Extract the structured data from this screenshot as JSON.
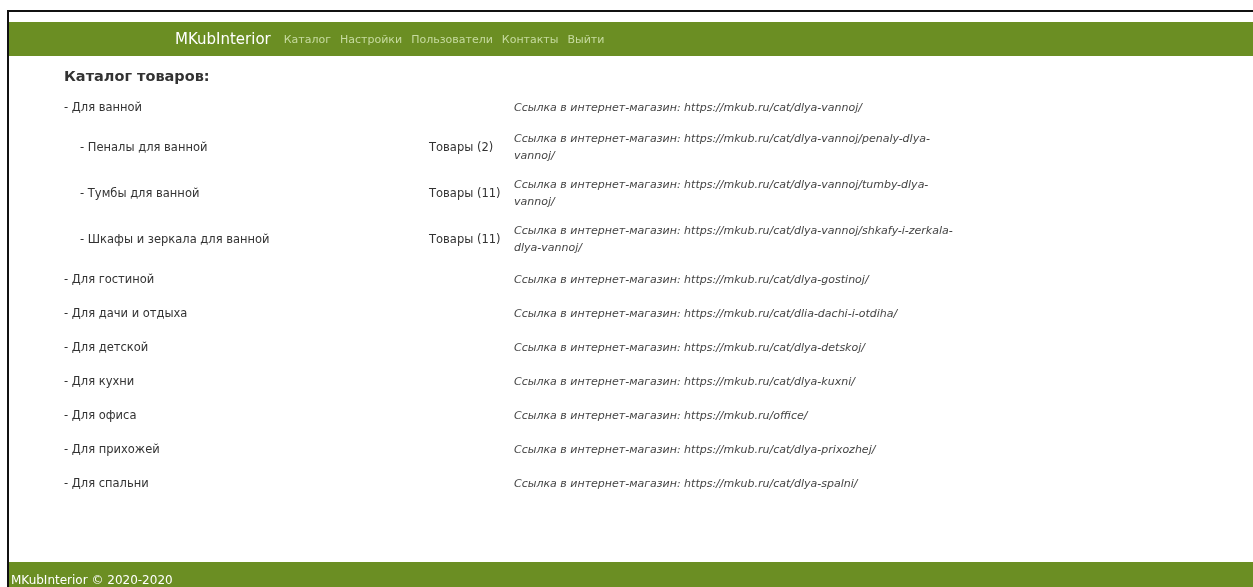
{
  "navbar": {
    "brand": "MKubInterior",
    "links": [
      "Каталог",
      "Настройки",
      "Пользователи",
      "Контакты",
      "Выйти"
    ]
  },
  "heading": "Каталог товаров:",
  "categories": [
    {
      "name": "- Для ванной",
      "link": "Ссылка в интернет-магазин: https://mkub.ru/cat/dlya-vannoj/",
      "children": [
        {
          "name": "- Пеналы для ванной",
          "count": "Товары (2)",
          "link": "Ссылка в интернет-магазин: https://mkub.ru/cat/dlya-vannoj/penaly-dlya-vannoj/"
        },
        {
          "name": "- Тумбы для ванной",
          "count": "Товары (11)",
          "link": "Ссылка в интернет-магазин: https://mkub.ru/cat/dlya-vannoj/tumby-dlya-vannoj/"
        },
        {
          "name": "- Шкафы и зеркала для ванной",
          "count": "Товары (11)",
          "link": "Ссылка в интернет-магазин: https://mkub.ru/cat/dlya-vannoj/shkafy-i-zerkala-dlya-vannoj/"
        }
      ]
    },
    {
      "name": "- Для гостиной",
      "link": "Ссылка в интернет-магазин: https://mkub.ru/cat/dlya-gostinoj/"
    },
    {
      "name": "- Для дачи и отдыха",
      "link": "Ссылка в интернет-магазин: https://mkub.ru/cat/dlia-dachi-i-otdiha/"
    },
    {
      "name": "- Для детской",
      "link": "Ссылка в интернет-магазин: https://mkub.ru/cat/dlya-detskoj/"
    },
    {
      "name": "- Для кухни",
      "link": "Ссылка в интернет-магазин: https://mkub.ru/cat/dlya-kuxni/"
    },
    {
      "name": "- Для офиса",
      "link": "Ссылка в интернет-магазин: https://mkub.ru/office/"
    },
    {
      "name": "- Для прихожей",
      "link": "Ссылка в интернет-магазин: https://mkub.ru/cat/dlya-prixozhej/"
    },
    {
      "name": "- Для спальни",
      "link": "Ссылка в интернет-магазин: https://mkub.ru/cat/dlya-spalni/"
    }
  ],
  "footer": "MKubInterior © 2020-2020"
}
